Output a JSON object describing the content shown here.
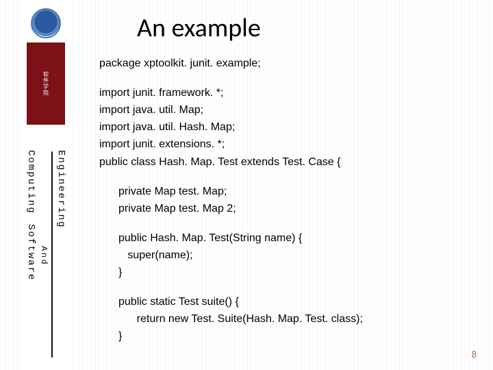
{
  "sidebar": {
    "seal_text": "软件学院",
    "vertical": {
      "left_top": "Computing",
      "left_bottom": "Software",
      "mid": "And",
      "right": "Engineering"
    }
  },
  "title": "An example",
  "code": {
    "l01": "package xptoolkit. junit. example;",
    "l02": "import junit. framework. *;",
    "l03": "import java. util. Map;",
    "l04": "import java. util. Hash. Map;",
    "l05": "import junit. extensions. *;",
    "l06": "public class Hash. Map. Test extends Test. Case {",
    "l07": "private Map test. Map;",
    "l08": "private Map test. Map 2;",
    "l09": "public Hash. Map. Test(String name) {",
    "l10": "   super(name);",
    "l11": "}",
    "l12": "public static Test suite() {",
    "l13": "      return new Test. Suite(Hash. Map. Test. class);",
    "l14": "}"
  },
  "page_number": "8"
}
